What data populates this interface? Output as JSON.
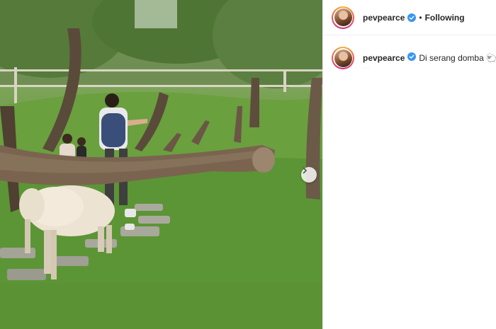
{
  "post": {
    "author": "pevpearce",
    "separator": "•",
    "follow_status": "Following",
    "caption": "Di serang domba 🐑",
    "caption_cont": "..."
  },
  "icons": {
    "verified": "verified-badge-icon",
    "next": "chevron-right-icon"
  },
  "colors": {
    "verified": "#3897f0",
    "text": "#262626",
    "grass": "#5f9436"
  }
}
